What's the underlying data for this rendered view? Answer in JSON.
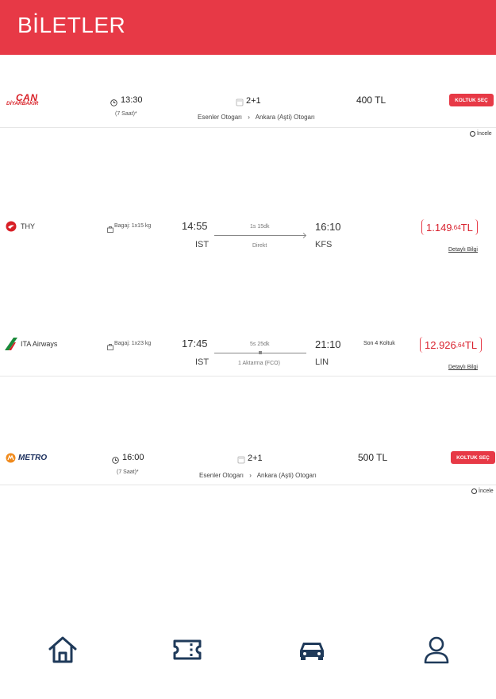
{
  "header": {
    "title": "BİLETLER"
  },
  "bus_tickets": [
    {
      "company_logo_text": [
        "CAN",
        "DİYARBAKIR"
      ],
      "departure_time": "13:30",
      "duration": "(7 Saat)*",
      "seat_layout": "2+1",
      "route_from": "Esenler Otogarı",
      "route_sep": "›",
      "route_to": "Ankara (Aşti) Otogarı",
      "price": "400 TL",
      "select_label": "KOLTUK SEÇ",
      "detail_label": "İncele"
    },
    {
      "company_logo_text": [
        "METRO"
      ],
      "departure_time": "16:00",
      "duration": "(7 Saat)*",
      "seat_layout": "2+1",
      "route_from": "Esenler Otogarı",
      "route_sep": "›",
      "route_to": "Ankara (Aşti) Otogarı",
      "price": "500 TL",
      "select_label": "KOLTUK SEÇ",
      "detail_label": "İncele"
    }
  ],
  "flights": [
    {
      "airline": "THY",
      "baggage": "Bagaj: 1x15 kg",
      "dep_time": "14:55",
      "dep_code": "IST",
      "duration": "1s 15dk",
      "stops": "Direkt",
      "arr_time": "16:10",
      "arr_code": "KFS",
      "seats_left": "",
      "price_main": "1.149",
      "price_cents": ",64",
      "currency": "TL",
      "detail_label": "Detaylı Bilgi"
    },
    {
      "airline": "ITA Airways",
      "baggage": "Bagaj: 1x23 kg",
      "dep_time": "17:45",
      "dep_code": "IST",
      "duration": "5s 25dk",
      "stops": "1 Aktarma (FCO)",
      "arr_time": "21:10",
      "arr_code": "LIN",
      "seats_left": "Son 4 Koltuk",
      "price_main": "12.926",
      "price_cents": ",64",
      "currency": "TL",
      "detail_label": "Detaylı Bilgi"
    }
  ],
  "colors": {
    "brand_red": "#e73946",
    "nav_icon": "#1f3a5a"
  },
  "bottom_nav": [
    {
      "icon": "home-icon"
    },
    {
      "icon": "ticket-icon"
    },
    {
      "icon": "car-icon"
    },
    {
      "icon": "user-icon"
    }
  ]
}
